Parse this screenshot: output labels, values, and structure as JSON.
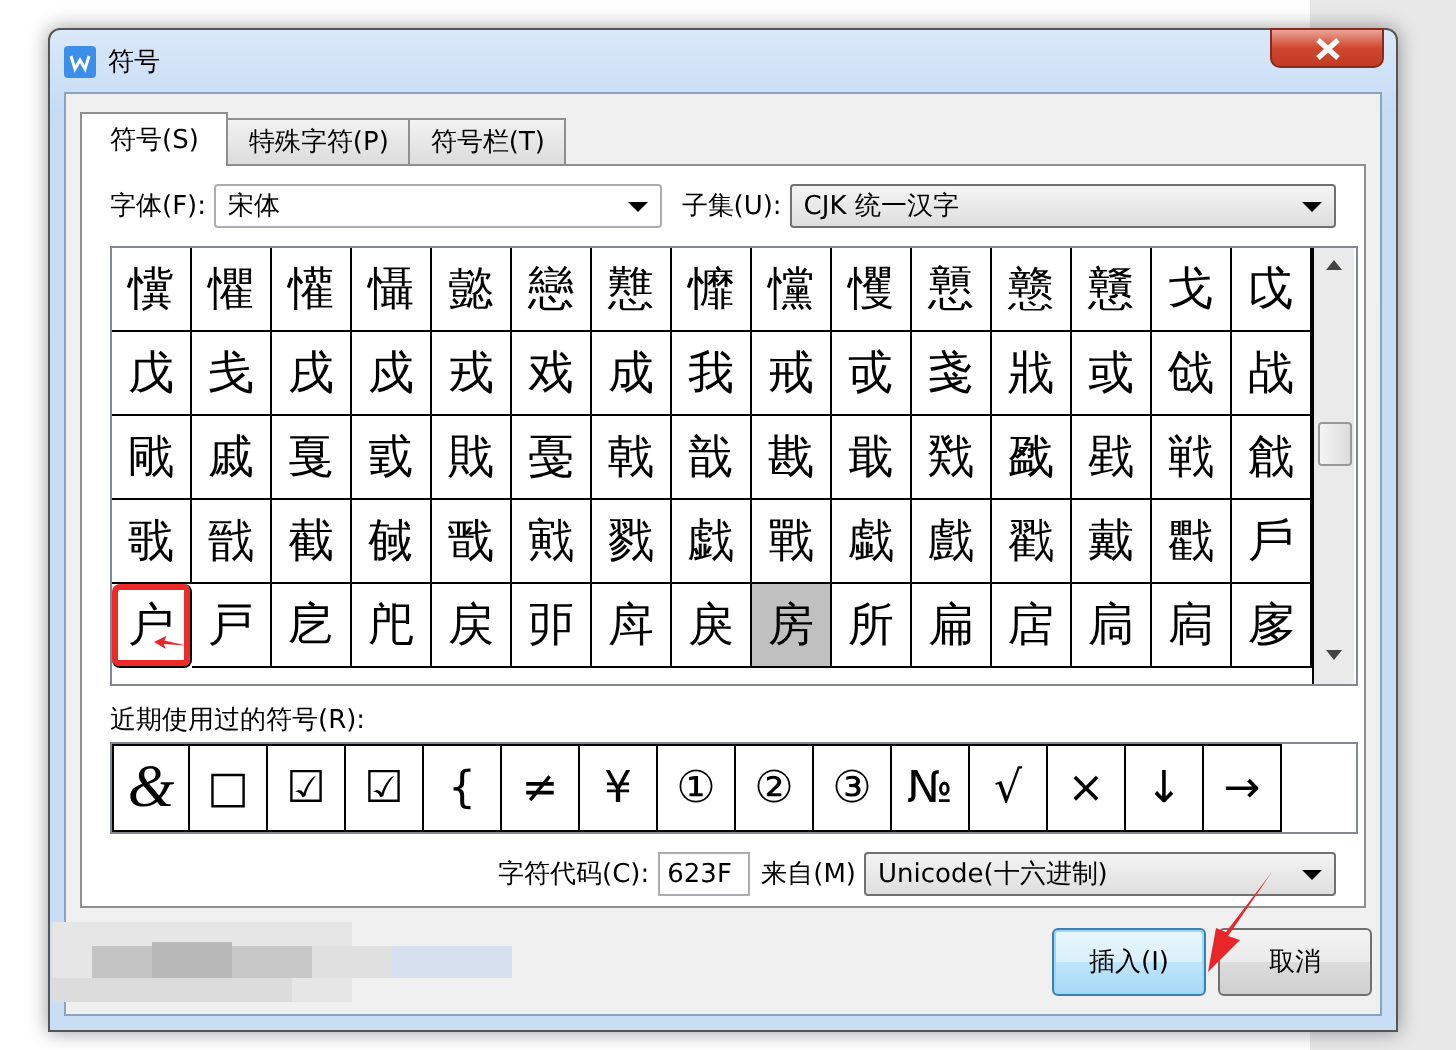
{
  "window": {
    "title": "符号"
  },
  "tabs": [
    {
      "label": "符号(S)",
      "selected": true
    },
    {
      "label": "特殊字符(P)",
      "selected": false
    },
    {
      "label": "符号栏(T)",
      "selected": false
    }
  ],
  "font": {
    "label": "字体(F):",
    "value": "宋体"
  },
  "subset": {
    "label": "子集(U):",
    "value": "CJK 统一汉字"
  },
  "symbols": [
    {
      "char": "懻",
      "selected": false,
      "circled": false
    },
    {
      "char": "懼",
      "selected": false,
      "circled": false
    },
    {
      "char": "懽",
      "selected": false,
      "circled": false
    },
    {
      "char": "懾",
      "selected": false,
      "circled": false
    },
    {
      "char": "懿",
      "selected": false,
      "circled": false
    },
    {
      "char": "戀",
      "selected": false,
      "circled": false
    },
    {
      "char": "戁",
      "selected": false,
      "circled": false
    },
    {
      "char": "戂",
      "selected": false,
      "circled": false
    },
    {
      "char": "戃",
      "selected": false,
      "circled": false
    },
    {
      "char": "戄",
      "selected": false,
      "circled": false
    },
    {
      "char": "戅",
      "selected": false,
      "circled": false
    },
    {
      "char": "戆",
      "selected": false,
      "circled": false
    },
    {
      "char": "戇",
      "selected": false,
      "circled": false
    },
    {
      "char": "戈",
      "selected": false,
      "circled": false
    },
    {
      "char": "戉",
      "selected": false,
      "circled": false
    },
    {
      "char": "戊",
      "selected": false,
      "circled": false
    },
    {
      "char": "戋",
      "selected": false,
      "circled": false
    },
    {
      "char": "戌",
      "selected": false,
      "circled": false
    },
    {
      "char": "戍",
      "selected": false,
      "circled": false
    },
    {
      "char": "戎",
      "selected": false,
      "circled": false
    },
    {
      "char": "戏",
      "selected": false,
      "circled": false
    },
    {
      "char": "成",
      "selected": false,
      "circled": false
    },
    {
      "char": "我",
      "selected": false,
      "circled": false
    },
    {
      "char": "戒",
      "selected": false,
      "circled": false
    },
    {
      "char": "戓",
      "selected": false,
      "circled": false
    },
    {
      "char": "戔",
      "selected": false,
      "circled": false
    },
    {
      "char": "戕",
      "selected": false,
      "circled": false
    },
    {
      "char": "或",
      "selected": false,
      "circled": false
    },
    {
      "char": "戗",
      "selected": false,
      "circled": false
    },
    {
      "char": "战",
      "selected": false,
      "circled": false
    },
    {
      "char": "戙",
      "selected": false,
      "circled": false
    },
    {
      "char": "戚",
      "selected": false,
      "circled": false
    },
    {
      "char": "戛",
      "selected": false,
      "circled": false
    },
    {
      "char": "戜",
      "selected": false,
      "circled": false
    },
    {
      "char": "戝",
      "selected": false,
      "circled": false
    },
    {
      "char": "戞",
      "selected": false,
      "circled": false
    },
    {
      "char": "戟",
      "selected": false,
      "circled": false
    },
    {
      "char": "戠",
      "selected": false,
      "circled": false
    },
    {
      "char": "戡",
      "selected": false,
      "circled": false
    },
    {
      "char": "戢",
      "selected": false,
      "circled": false
    },
    {
      "char": "戣",
      "selected": false,
      "circled": false
    },
    {
      "char": "戤",
      "selected": false,
      "circled": false
    },
    {
      "char": "戥",
      "selected": false,
      "circled": false
    },
    {
      "char": "戦",
      "selected": false,
      "circled": false
    },
    {
      "char": "戧",
      "selected": false,
      "circled": false
    },
    {
      "char": "戨",
      "selected": false,
      "circled": false
    },
    {
      "char": "戩",
      "selected": false,
      "circled": false
    },
    {
      "char": "截",
      "selected": false,
      "circled": false
    },
    {
      "char": "戫",
      "selected": false,
      "circled": false
    },
    {
      "char": "戬",
      "selected": false,
      "circled": false
    },
    {
      "char": "戭",
      "selected": false,
      "circled": false
    },
    {
      "char": "戮",
      "selected": false,
      "circled": false
    },
    {
      "char": "戯",
      "selected": false,
      "circled": false
    },
    {
      "char": "戰",
      "selected": false,
      "circled": false
    },
    {
      "char": "戱",
      "selected": false,
      "circled": false
    },
    {
      "char": "戲",
      "selected": false,
      "circled": false
    },
    {
      "char": "戳",
      "selected": false,
      "circled": false
    },
    {
      "char": "戴",
      "selected": false,
      "circled": false
    },
    {
      "char": "戵",
      "selected": false,
      "circled": false
    },
    {
      "char": "戶",
      "selected": false,
      "circled": false
    },
    {
      "char": "户",
      "selected": false,
      "circled": true
    },
    {
      "char": "戸",
      "selected": false,
      "circled": false
    },
    {
      "char": "戹",
      "selected": false,
      "circled": false
    },
    {
      "char": "戺",
      "selected": false,
      "circled": false
    },
    {
      "char": "戻",
      "selected": false,
      "circled": false
    },
    {
      "char": "戼",
      "selected": false,
      "circled": false
    },
    {
      "char": "戽",
      "selected": false,
      "circled": false
    },
    {
      "char": "戾",
      "selected": false,
      "circled": false
    },
    {
      "char": "房",
      "selected": true,
      "circled": false
    },
    {
      "char": "所",
      "selected": false,
      "circled": false
    },
    {
      "char": "扁",
      "selected": false,
      "circled": false
    },
    {
      "char": "扂",
      "selected": false,
      "circled": false
    },
    {
      "char": "扃",
      "selected": false,
      "circled": false
    },
    {
      "char": "扄",
      "selected": false,
      "circled": false
    },
    {
      "char": "扅",
      "selected": false,
      "circled": false
    }
  ],
  "recent": {
    "label": "近期使用过的符号(R):",
    "symbols": [
      "&",
      "□",
      "☑",
      "☑",
      "{",
      "≠",
      "¥",
      "①",
      "②",
      "③",
      "№",
      "√",
      "×",
      "↓",
      "→"
    ]
  },
  "char_code": {
    "label": "字符代码(C):",
    "value": "623F"
  },
  "from": {
    "label": "来自(M)",
    "value": "Unicode(十六进制)"
  },
  "buttons": [
    {
      "label": "插入(I)",
      "default": true,
      "pointed": true
    },
    {
      "label": "取消",
      "default": false,
      "pointed": false
    }
  ]
}
